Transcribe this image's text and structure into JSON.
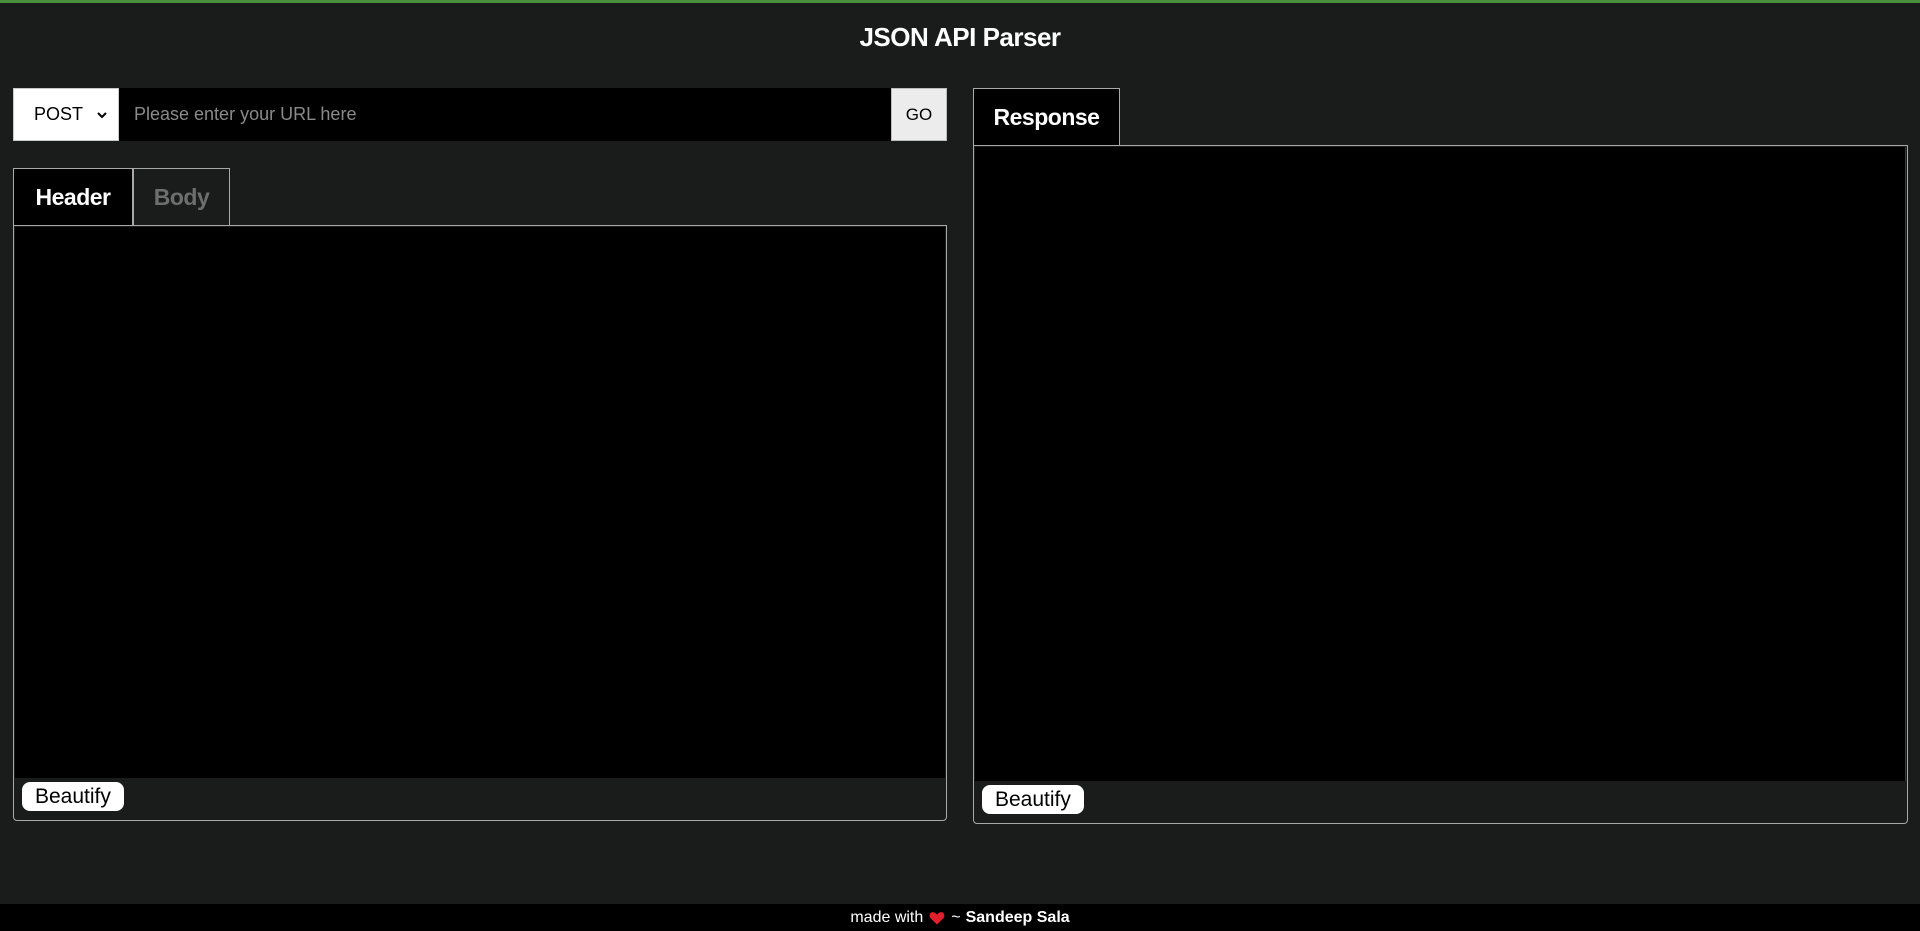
{
  "header": {
    "title": "JSON API Parser",
    "accent_color": "#4a8f3c"
  },
  "request": {
    "method": "POST",
    "url_placeholder": "Please enter your URL here",
    "url_value": "",
    "go_label": "GO"
  },
  "request_panel": {
    "tabs": [
      {
        "label": "Header",
        "active": true
      },
      {
        "label": "Body",
        "active": false
      }
    ],
    "beautify_label": "Beautify"
  },
  "response_panel": {
    "tabs": [
      {
        "label": "Response",
        "active": true
      }
    ],
    "beautify_label": "Beautify"
  },
  "footer": {
    "prefix": "made with",
    "heart_icon": "heart-icon",
    "separator": "~",
    "author": "Sandeep Sala",
    "heart_color": "#e0202a"
  }
}
